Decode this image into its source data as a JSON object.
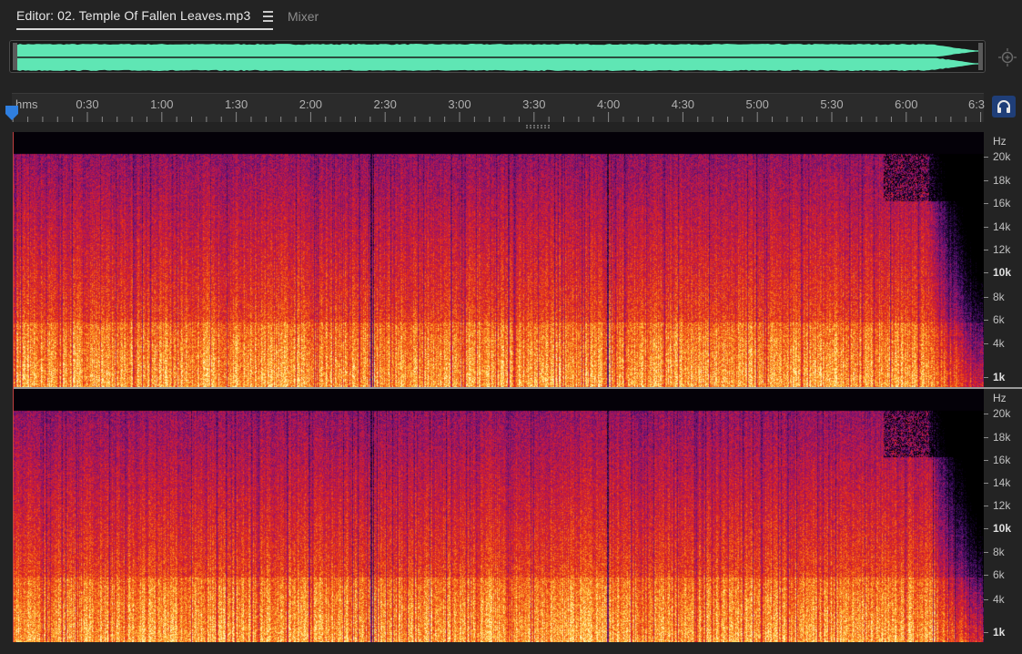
{
  "tabs": {
    "editor_label": "Editor: 02. Temple Of Fallen Leaves.mp3",
    "mixer_label": "Mixer"
  },
  "colors": {
    "waveform": "#5fe6b4",
    "accent_button": "#1f3e78",
    "playhead": "#2f7fe0"
  },
  "ruler": {
    "unit": "hms",
    "ticks": [
      "0:30",
      "1:00",
      "1:30",
      "2:00",
      "2:30",
      "3:00",
      "3:30",
      "4:00",
      "4:30",
      "5:00",
      "5:30",
      "6:00",
      "6:3"
    ]
  },
  "frequency_scale": {
    "unit": "Hz",
    "labels": [
      {
        "text": "20k",
        "bold": false
      },
      {
        "text": "18k",
        "bold": false
      },
      {
        "text": "16k",
        "bold": false
      },
      {
        "text": "14k",
        "bold": false
      },
      {
        "text": "12k",
        "bold": false
      },
      {
        "text": "10k",
        "bold": true
      },
      {
        "text": "8k",
        "bold": false
      },
      {
        "text": "6k",
        "bold": false
      },
      {
        "text": "4k",
        "bold": false
      },
      {
        "text": "1k",
        "bold": true
      }
    ]
  },
  "icons": {
    "zoom": "zoom-to-selection-icon",
    "monitor": "headphones-icon",
    "menu": "hamburger-menu-icon"
  }
}
